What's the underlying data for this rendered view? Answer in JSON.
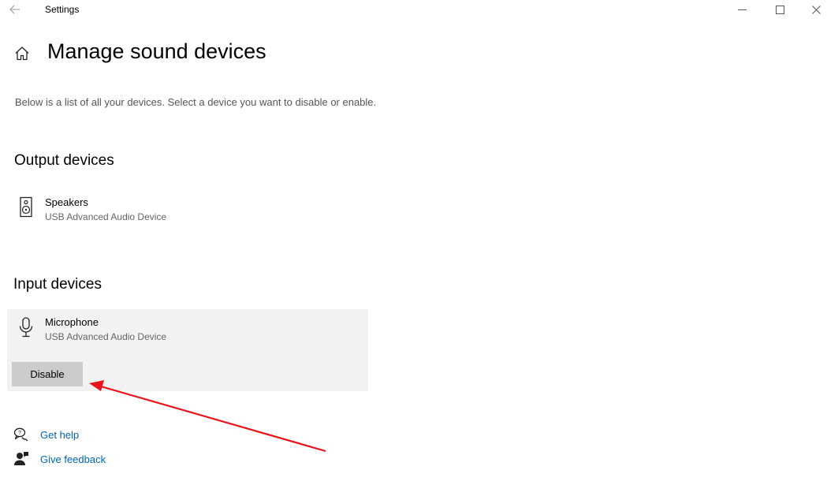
{
  "window": {
    "title": "Settings",
    "back_icon": "arrow-left-icon",
    "controls": [
      "minimize-icon",
      "maximize-icon",
      "close-icon"
    ]
  },
  "page": {
    "home_icon": "home-icon",
    "title": "Manage sound devices",
    "description": "Below is a list of all your devices. Select a device you want to disable or enable."
  },
  "output_section": {
    "heading": "Output devices",
    "devices": [
      {
        "name": "Speakers",
        "subtitle": "USB Advanced Audio Device",
        "icon": "speaker-icon"
      }
    ]
  },
  "input_section": {
    "heading": "Input devices",
    "devices": [
      {
        "name": "Microphone",
        "subtitle": "USB Advanced Audio Device",
        "icon": "microphone-icon",
        "selected": true,
        "button_label": "Disable"
      }
    ]
  },
  "help_links": [
    {
      "label": "Get help",
      "icon": "help-chat-icon"
    },
    {
      "label": "Give feedback",
      "icon": "feedback-icon"
    }
  ],
  "colors": {
    "link": "#0063b1",
    "selected_bg": "#f2f2f2",
    "button_bg": "#cccccc",
    "annotation_arrow": "#e8141b"
  },
  "annotation": {
    "type": "arrow",
    "points_to": "disable-button"
  }
}
